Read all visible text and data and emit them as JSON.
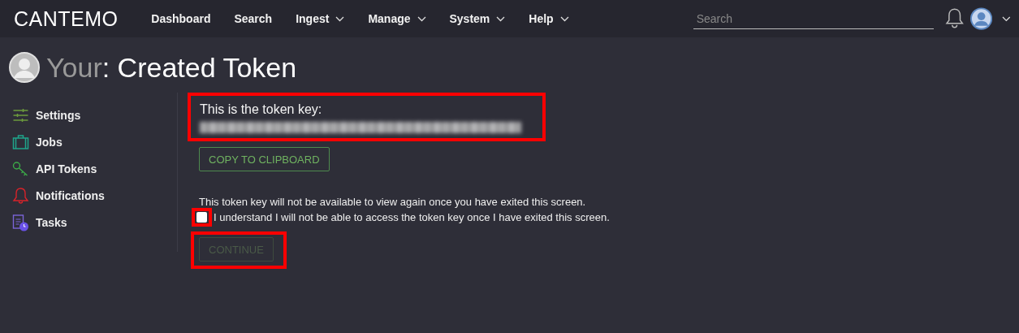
{
  "navbar": {
    "logo": "CANTEMO",
    "items": [
      {
        "label": "Dashboard",
        "has_menu": false
      },
      {
        "label": "Search",
        "has_menu": false
      },
      {
        "label": "Ingest",
        "has_menu": true
      },
      {
        "label": "Manage",
        "has_menu": true
      },
      {
        "label": "System",
        "has_menu": true
      },
      {
        "label": "Help",
        "has_menu": true
      }
    ],
    "search": {
      "placeholder": "Search"
    }
  },
  "page_title": {
    "prefix": "Your",
    "title": ": Created Token"
  },
  "sidebar": {
    "items": [
      {
        "label": "Settings",
        "kind": "settings"
      },
      {
        "label": "Jobs",
        "kind": "jobs"
      },
      {
        "label": "API Tokens",
        "kind": "tokens"
      },
      {
        "label": "Notifications",
        "kind": "notifications"
      },
      {
        "label": "Tasks",
        "kind": "tasks"
      }
    ]
  },
  "token_panel": {
    "heading": "This is the token key:",
    "highlighted": true
  },
  "copy_button": {
    "label": "COPY TO CLIPBOARD"
  },
  "warning": "This token key will not be available to view again once you have exited this screen.",
  "confirm": {
    "label": "I understand I will not be able to access the token key once I have exited this screen.",
    "checked": false,
    "highlighted": true
  },
  "continue_button": {
    "label": "CONTINUE",
    "disabled": true,
    "highlighted": true
  }
}
